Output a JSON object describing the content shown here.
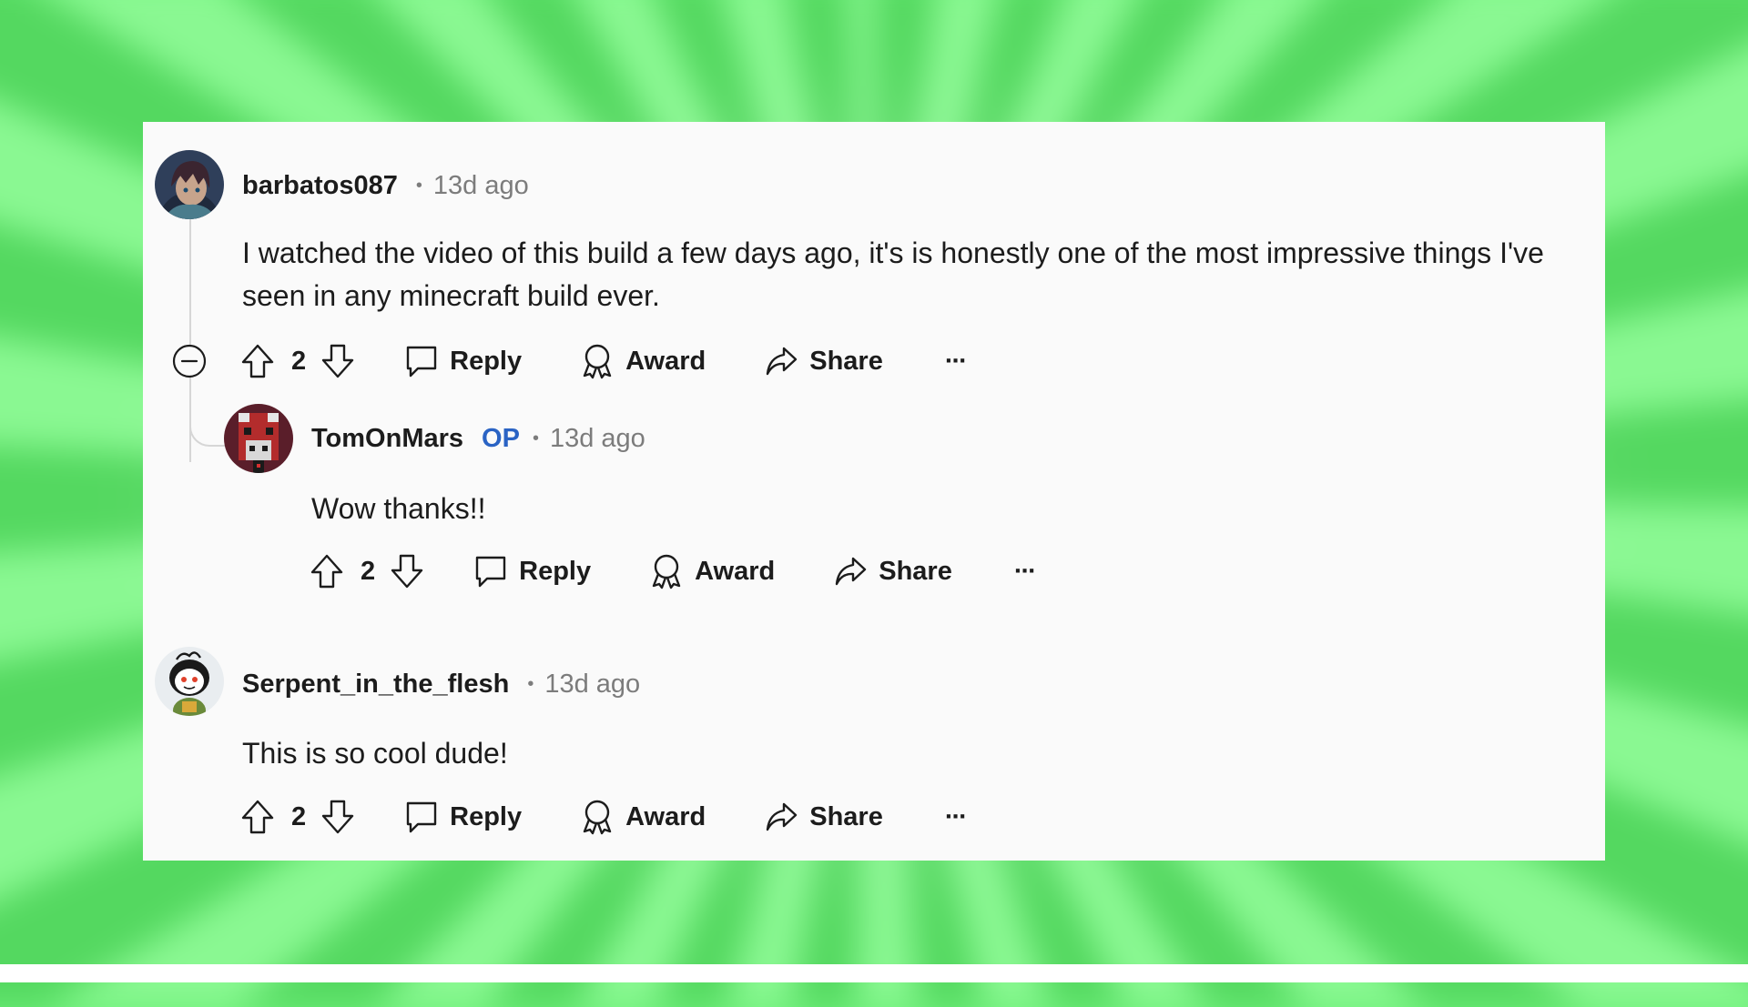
{
  "comments": [
    {
      "username": "barbatos087",
      "separator": "•",
      "time": "13d ago",
      "body": "I watched the video of this build a few days ago, it's is honestly one of the most impressive things I've seen in any minecraft build ever.",
      "votes": "2",
      "avatar_icon": "anime-character-avatar",
      "replies": [
        {
          "username": "TomOnMars",
          "badge": "OP",
          "separator": "•",
          "time": "13d ago",
          "body": "Wow thanks!!",
          "votes": "2",
          "avatar_icon": "minecraft-mooshroom-avatar"
        }
      ]
    },
    {
      "username": "Serpent_in_the_flesh",
      "separator": "•",
      "time": "13d ago",
      "body": "This is so cool dude!",
      "votes": "2",
      "avatar_icon": "reddit-snoo-avatar"
    }
  ],
  "actions": {
    "reply": "Reply",
    "award": "Award",
    "share": "Share",
    "more": "···"
  },
  "colors": {
    "op_badge": "#2a63c4",
    "background": "#6ef07a",
    "card": "#fafafa",
    "text": "#1c1c1c",
    "muted": "#7c7c7c"
  }
}
